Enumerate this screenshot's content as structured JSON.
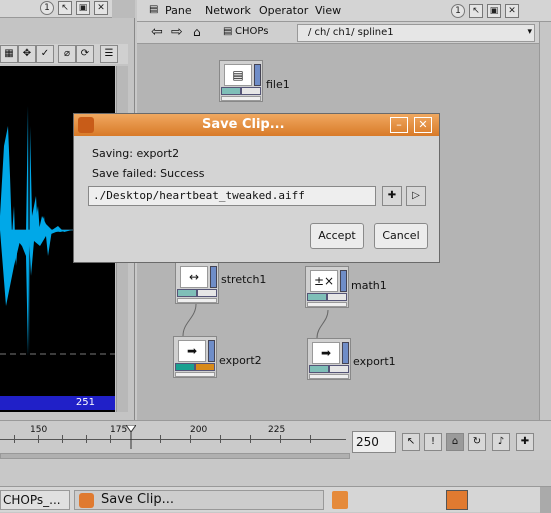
{
  "left_pane": {
    "header_icons": [
      "help-icon",
      "pin-icon",
      "copy-icon",
      "close-icon"
    ],
    "toolbar_icons": [
      "view-icon",
      "move-icon",
      "check-icon",
      "pin-off-icon",
      "sync-icon",
      "list-icon"
    ],
    "frame_readout": "251"
  },
  "network_pane": {
    "menu": [
      "Pane",
      "Network",
      "Operator",
      "View"
    ],
    "context_label": "CHOPs",
    "path": "/ ch/ ch1/ spline1",
    "nodes": [
      {
        "name": "file1"
      },
      {
        "name": "stretch1"
      },
      {
        "name": "math1"
      },
      {
        "name": "export2"
      },
      {
        "name": "export1"
      }
    ]
  },
  "dialog": {
    "title": "Save Clip...",
    "saving_text": "Saving: export2",
    "status_text": "Save failed: Success",
    "file_path": "./Desktop/heartbeat_tweaked.aiff",
    "accept_label": "Accept",
    "cancel_label": "Cancel"
  },
  "timeline": {
    "ticks": [
      "150",
      "175",
      "200",
      "225"
    ],
    "frame_value": "250"
  },
  "taskbar": {
    "items": [
      "CHOPs_...",
      "Save Clip..."
    ]
  },
  "colors": {
    "dialog_title_bar": "#e58a3a",
    "waveform": "#00a8e8",
    "wave_bg": "#000000",
    "readout_bg": "#2020c8"
  }
}
